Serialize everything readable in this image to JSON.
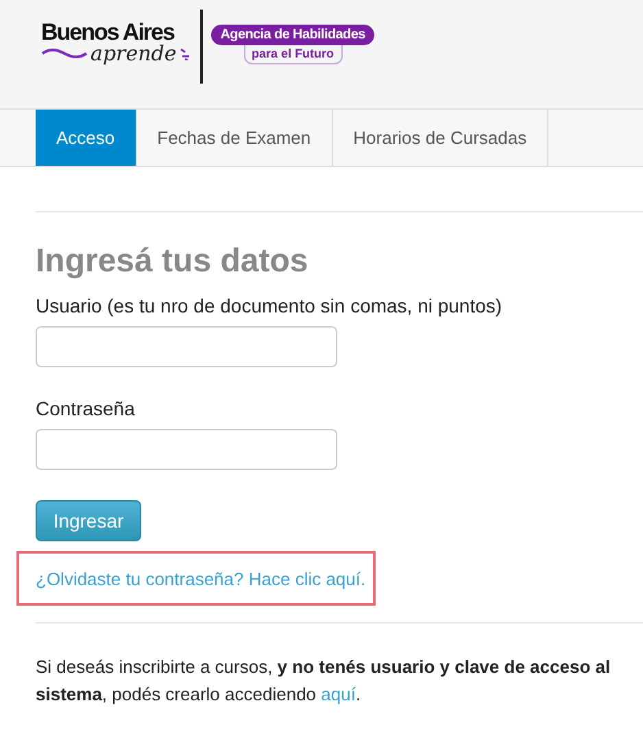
{
  "logo": {
    "line1": "Buenos Aires",
    "line2": "aprende",
    "badge_top": "Agencia de Habilidades",
    "badge_bottom": "para el Futuro"
  },
  "tabs": [
    {
      "label": "Acceso",
      "selected": true
    },
    {
      "label": "Fechas de Examen",
      "selected": false
    },
    {
      "label": "Horarios de Cursadas",
      "selected": false
    }
  ],
  "form": {
    "title": "Ingresá tus datos",
    "fields": [
      {
        "label": "Usuario (es tu nro de documento sin comas, ni puntos)"
      },
      {
        "label": "Contraseña"
      }
    ],
    "submit": "Ingresar",
    "forgot_link": "¿Olvidaste tu contraseña? Hace clic aquí."
  },
  "signup": {
    "text": "Si deseás inscribirte a cursos, **y no tenés usuario y clave de acceso al sistema**, podés crearlo accediendo ",
    "link": "aquí",
    "after": "."
  }
}
